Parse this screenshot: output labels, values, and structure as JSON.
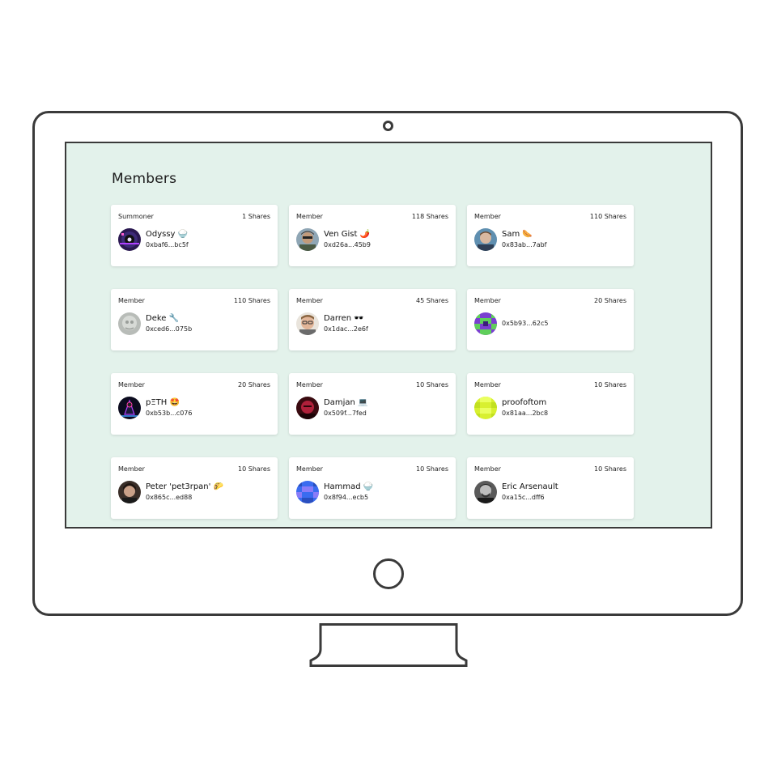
{
  "page": {
    "title": "Members"
  },
  "members": [
    {
      "role": "Summoner",
      "shares": "1 Shares",
      "name": "Odyssy 🍚",
      "address": "0xbaf6...bc5f",
      "avatar": "dark-purple-disc-avatar"
    },
    {
      "role": "Member",
      "shares": "118 Shares",
      "name": "Ven Gist 🌶️",
      "address": "0xd26a...45b9",
      "avatar": "sunglasses-photo-avatar"
    },
    {
      "role": "Member",
      "shares": "110 Shares",
      "name": "Sam 🌭",
      "address": "0x83ab...7abf",
      "avatar": "blue-photo-avatar"
    },
    {
      "role": "Member",
      "shares": "110 Shares",
      "name": "Deke 🔧",
      "address": "0xced6...075b",
      "avatar": "grey-blur-avatar"
    },
    {
      "role": "Member",
      "shares": "45 Shares",
      "name": "Darren 🕶️",
      "address": "0x1dac...2e6f",
      "avatar": "glasses-photo-avatar"
    },
    {
      "role": "Member",
      "shares": "20 Shares",
      "name": "",
      "address": "0x5b93...62c5",
      "avatar": "green-purple-identicon-avatar"
    },
    {
      "role": "Member",
      "shares": "20 Shares",
      "name": "pΞTH 🤩",
      "address": "0xb53b...c076",
      "avatar": "neon-figure-avatar"
    },
    {
      "role": "Member",
      "shares": "10 Shares",
      "name": "Damjan 💻",
      "address": "0x509f...7fed",
      "avatar": "red-photo-avatar"
    },
    {
      "role": "Member",
      "shares": "10 Shares",
      "name": "proofoftom",
      "address": "0x81aa...2bc8",
      "avatar": "lime-identicon-avatar"
    },
    {
      "role": "Member",
      "shares": "10 Shares",
      "name": "Peter 'pet3rpan' 🌮",
      "address": "0x865c...ed88",
      "avatar": "portrait-photo-avatar"
    },
    {
      "role": "Member",
      "shares": "10 Shares",
      "name": "Hammad 🍚",
      "address": "0x8f94...ecb5",
      "avatar": "blue-identicon-avatar"
    },
    {
      "role": "Member",
      "shares": "10 Shares",
      "name": "Eric Arsenault",
      "address": "0xa15c...dff6",
      "avatar": "bw-photo-avatar"
    }
  ],
  "colors": {
    "screen_bg": "#e3f2eb",
    "card_bg": "#ffffff",
    "frame": "#3a3a3a"
  }
}
